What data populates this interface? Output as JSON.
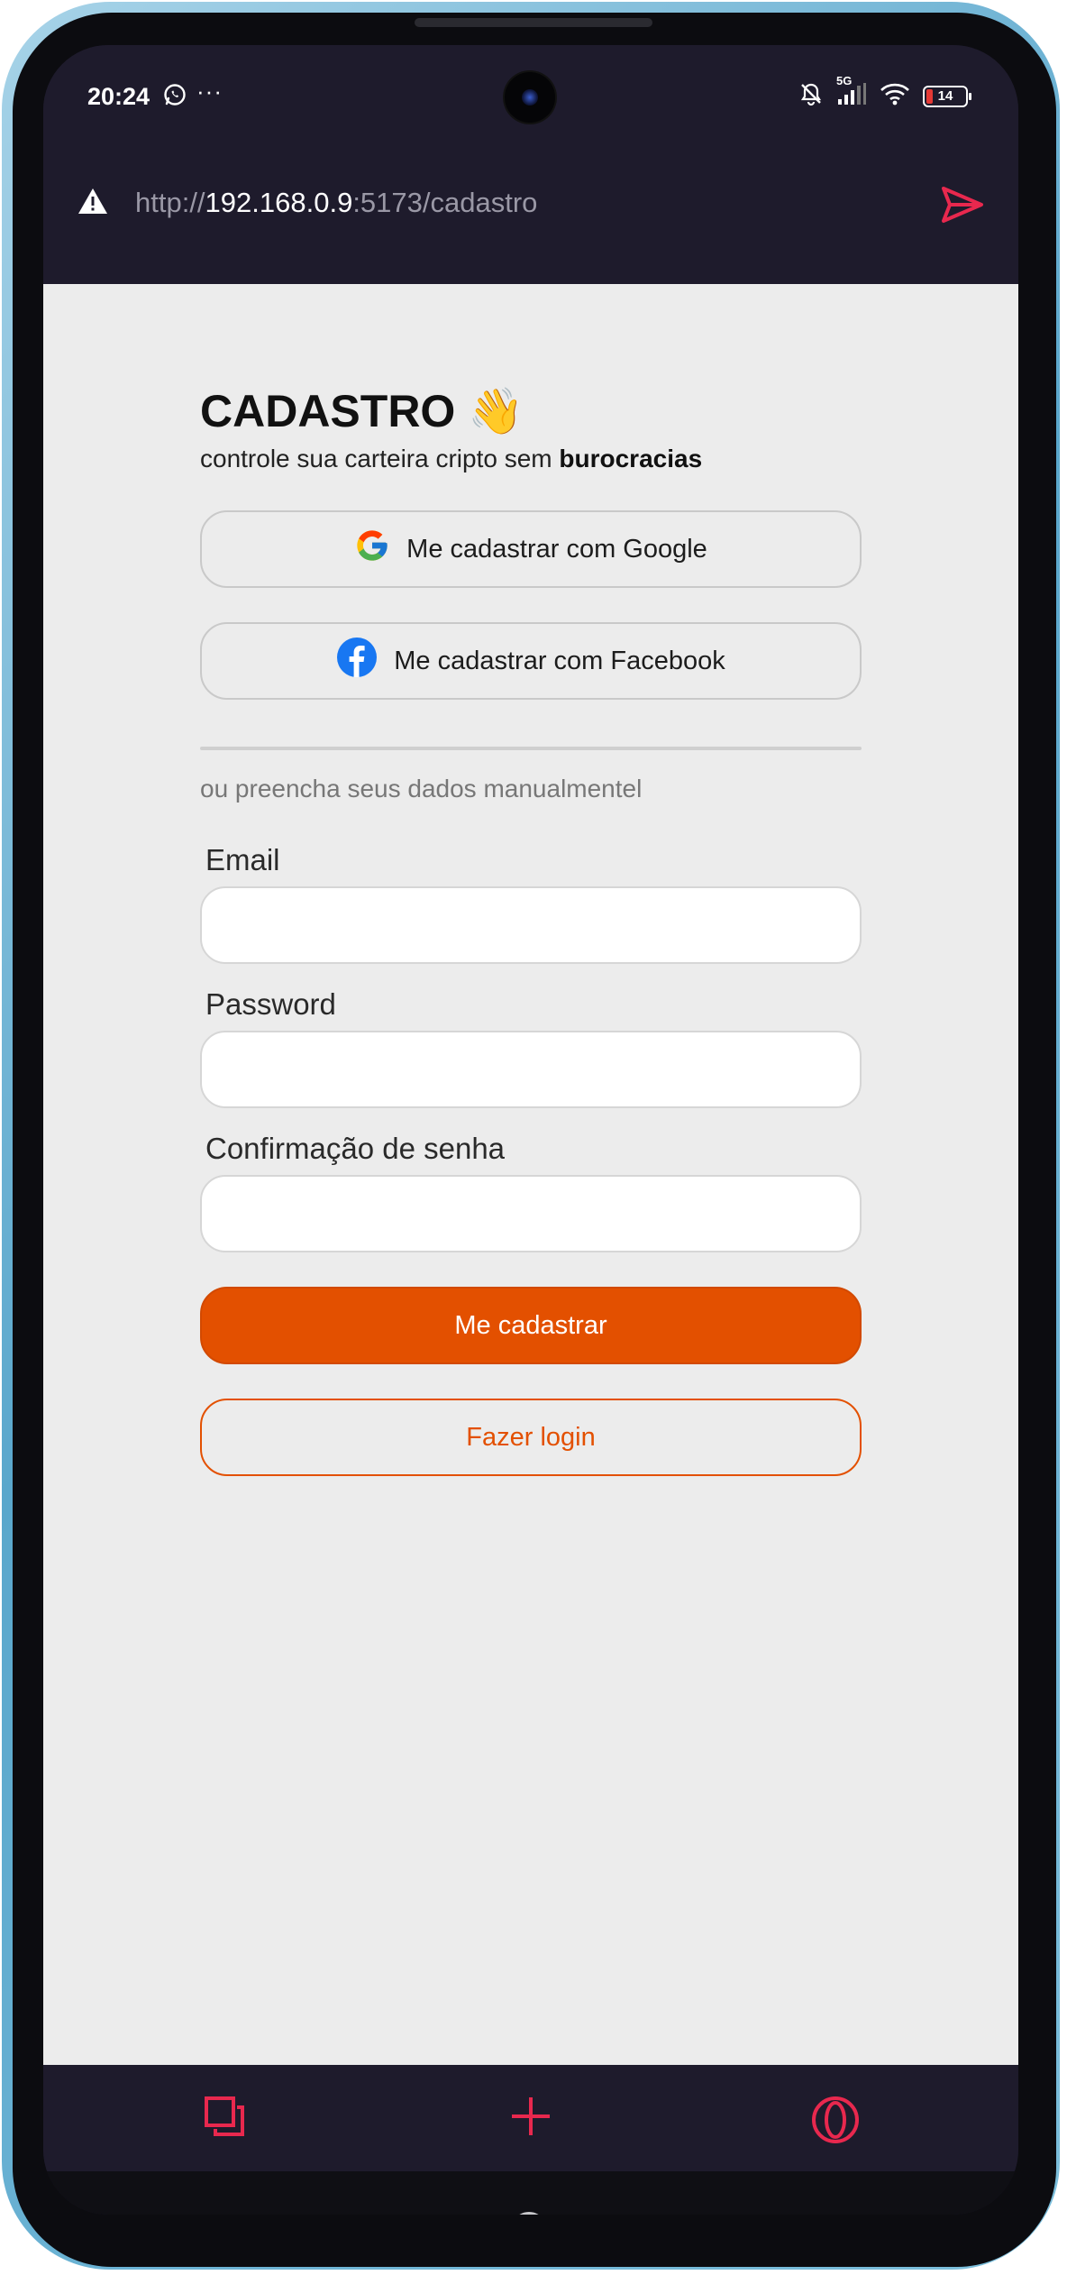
{
  "status_bar": {
    "time": "20:24",
    "overflow": "···",
    "network": "5G",
    "battery": "14",
    "icons": [
      "whatsapp-icon",
      "mute-icon",
      "signal-icon",
      "wifi-icon",
      "battery-icon"
    ]
  },
  "browser": {
    "url_prefix": "http://",
    "url_host": "192.168.0.9",
    "url_rest": ":5173/cadastro",
    "accent": "#e8284e"
  },
  "page": {
    "title": "CADASTRO 👋",
    "subtitle_text": "controle sua carteira cripto sem ",
    "subtitle_bold": "burocracias",
    "google_label": "Me cadastrar com Google",
    "facebook_label": "Me cadastrar com Facebook",
    "manual_text": "ou preencha seus dados manualmentel",
    "fields": {
      "email_label": "Email",
      "email_value": "",
      "password_label": "Password",
      "password_value": "",
      "confirm_label": "Confirmação de senha",
      "confirm_value": ""
    },
    "submit_label": "Me cadastrar",
    "login_label": "Fazer login",
    "accent": "#e35000"
  }
}
